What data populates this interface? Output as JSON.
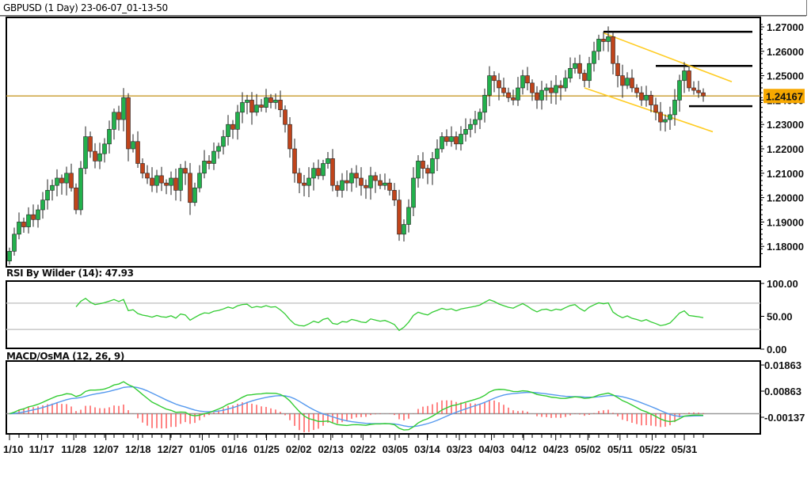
{
  "window": {
    "title": "GBPUSD (1 Day) 23-06-07_01-13-50"
  },
  "colors": {
    "bull": "#22b14c",
    "bear": "#c0441b",
    "price_line": "#c89a2a",
    "price_badge": "#f7a800",
    "trend": "#ffcc22",
    "rsi": "#33cc33",
    "macd": "#33cc33",
    "signal": "#5599ee",
    "osma": "#ff3333",
    "level": "#000000"
  },
  "chart_data": [
    {
      "type": "candlestick",
      "name": "GBPUSD",
      "timeframe": "1 Day",
      "ylim": [
        1.175,
        1.272
      ],
      "y_ticks": [
        "1.27000",
        "1.26000",
        "1.25000",
        "1.24000",
        "1.23000",
        "1.22000",
        "1.21000",
        "1.20000",
        "1.19000",
        "1.18000"
      ],
      "current_price": "1.24167",
      "x_ticks": [
        "1/10",
        "11/17",
        "11/28",
        "12/07",
        "12/18",
        "12/27",
        "01/05",
        "01/16",
        "01/25",
        "02/02",
        "02/13",
        "02/22",
        "03/05",
        "03/14",
        "03/23",
        "04/03",
        "04/12",
        "04/23",
        "05/02",
        "05/11",
        "05/22",
        "05/31"
      ],
      "closes": [
        1.178,
        1.185,
        1.19,
        1.188,
        1.193,
        1.191,
        1.195,
        1.199,
        1.203,
        1.205,
        1.208,
        1.206,
        1.21,
        1.204,
        1.195,
        1.212,
        1.225,
        1.219,
        1.215,
        1.218,
        1.222,
        1.228,
        1.235,
        1.232,
        1.241,
        1.22,
        1.223,
        1.214,
        1.21,
        1.208,
        1.205,
        1.209,
        1.206,
        1.205,
        1.208,
        1.203,
        1.212,
        1.21,
        1.198,
        1.204,
        1.21,
        1.215,
        1.214,
        1.219,
        1.221,
        1.225,
        1.23,
        1.228,
        1.235,
        1.239,
        1.24,
        1.235,
        1.238,
        1.237,
        1.241,
        1.239,
        1.24,
        1.236,
        1.23,
        1.22,
        1.21,
        1.206,
        1.205,
        1.208,
        1.212,
        1.209,
        1.214,
        1.216,
        1.205,
        1.203,
        1.207,
        1.206,
        1.21,
        1.208,
        1.205,
        1.204,
        1.209,
        1.207,
        1.205,
        1.206,
        1.203,
        1.199,
        1.185,
        1.189,
        1.196,
        1.208,
        1.215,
        1.212,
        1.21,
        1.216,
        1.22,
        1.225,
        1.223,
        1.225,
        1.222,
        1.226,
        1.228,
        1.23,
        1.232,
        1.235,
        1.242,
        1.25,
        1.248,
        1.245,
        1.243,
        1.241,
        1.24,
        1.245,
        1.25,
        1.247,
        1.243,
        1.24,
        1.244,
        1.245,
        1.243,
        1.246,
        1.245,
        1.249,
        1.253,
        1.255,
        1.251,
        1.248,
        1.255,
        1.26,
        1.265,
        1.264,
        1.266,
        1.255,
        1.25,
        1.246,
        1.249,
        1.245,
        1.243,
        1.24,
        1.242,
        1.238,
        1.235,
        1.231,
        1.232,
        1.234,
        1.24,
        1.248,
        1.252,
        1.245,
        1.244,
        1.243,
        1.2417
      ],
      "horizontal_levels": [
        1.2417
      ],
      "level_segments": [
        {
          "price": 1.268,
          "from_index": 125
        },
        {
          "price": 1.254,
          "from_index": 136
        },
        {
          "price": 1.2375,
          "from_index": 143
        }
      ],
      "trendlines": [
        {
          "from": [
            125,
            1.2675
          ],
          "to": [
            152,
            1.2475
          ]
        },
        {
          "from": [
            121,
            1.245
          ],
          "to": [
            148,
            1.227
          ]
        }
      ]
    },
    {
      "type": "line",
      "label": "RSI By Wilder (14): 47.93",
      "period": 14,
      "last_value": 47.93,
      "ylim": [
        0,
        100
      ],
      "levels": [
        30,
        70
      ],
      "y_ticks": [
        "100.00",
        "50.00",
        "0.00"
      ]
    },
    {
      "type": "line+bar",
      "label": "MACD/OsMA (12, 26, 9)",
      "params": [
        12,
        26,
        9
      ],
      "ylim": [
        -0.0077,
        0.02
      ],
      "y_ticks": [
        "0.01863",
        "0.00863",
        "-0.00137"
      ]
    }
  ]
}
